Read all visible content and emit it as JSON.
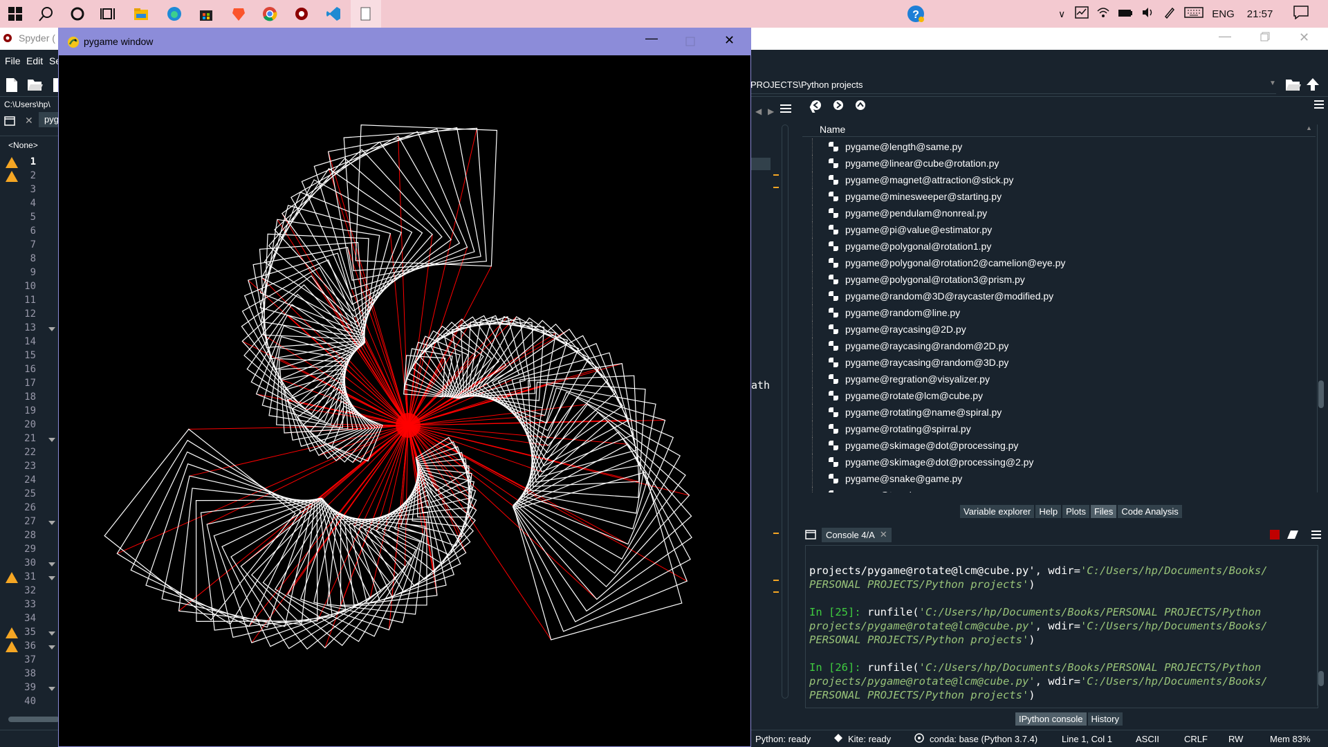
{
  "taskbar": {
    "language": "ENG",
    "time": "21:57",
    "icons": [
      "windows-start-icon",
      "search-icon",
      "cortana-icon",
      "task-view-icon",
      "file-explorer-icon",
      "edge-icon",
      "store-icon",
      "brave-icon",
      "chrome-icon",
      "spyder-icon",
      "vscode-icon",
      "blank-window-icon"
    ],
    "tray": [
      "help-icon",
      "chevron-up-icon",
      "task-manager-icon",
      "wifi-icon",
      "battery-icon",
      "volume-icon",
      "pen-icon",
      "keyboard-icon"
    ]
  },
  "spyder": {
    "title": "Spyder (",
    "menu": [
      "File",
      "Edit",
      "Se"
    ],
    "cwd_path": "C:\\Users\\hp\\",
    "editor_tab": "pyg",
    "outline_selector": "<None>",
    "line_numbers": [
      "1",
      "2",
      "3",
      "4",
      "5",
      "6",
      "7",
      "8",
      "9",
      "10",
      "11",
      "12",
      "13",
      "14",
      "15",
      "16",
      "17",
      "18",
      "19",
      "20",
      "21",
      "22",
      "23",
      "24",
      "25",
      "26",
      "27",
      "28",
      "29",
      "30",
      "31",
      "32",
      "33",
      "34",
      "35",
      "36",
      "37",
      "38",
      "39",
      "40"
    ],
    "middle_fragment": "ath",
    "files_path": "PROJECTS\\Python projects",
    "files_header": "Name",
    "files": [
      "pygame@length@same.py",
      "pygame@linear@cube@rotation.py",
      "pygame@magnet@attraction@stick.py",
      "pygame@minesweeper@starting.py",
      "pygame@pendulam@nonreal.py",
      "pygame@pi@value@estimator.py",
      "pygame@polygonal@rotation1.py",
      "pygame@polygonal@rotation2@camelion@eye.py",
      "pygame@polygonal@rotation3@prism.py",
      "pygame@random@3D@raycaster@modified.py",
      "pygame@random@line.py",
      "pygame@raycasing@2D.py",
      "pygame@raycasing@random@2D.py",
      "pygame@raycasing@random@3D.py",
      "pygame@regration@visyalizer.py",
      "pygame@rotate@lcm@cube.py",
      "pygame@rotating@name@spiral.py",
      "pygame@rotating@spirral.py",
      "pygame@skimage@dot@processing.py",
      "pygame@skimage@dot@processing@2.py",
      "pygame@snake@game.py",
      "pygame@terrain.py"
    ],
    "pane_tabs": [
      "Variable explorer",
      "Help",
      "Plots",
      "Files",
      "Code Analysis"
    ],
    "console_tab": "Console 4/A",
    "console_bottom_tabs": [
      "IPython console",
      "History"
    ],
    "console": {
      "l1_pre": "projects/pygame@rotate@lcm@cube.py', wdir=",
      "l1_str": "'C:/Users/hp/Documents/Books/",
      "l2_str": "PERSONAL PROJECTS/Python projects'",
      "l2_post": ")",
      "in25": "In [25]:",
      "in26": "In [26]:",
      "runfile": " runfile(",
      "path_a": "'C:/Users/hp/Documents/Books/PERSONAL PROJECTS/Python",
      "path_b": "projects/pygame@rotate@lcm@cube.py'",
      "wdir": ", wdir=",
      "wdir_a": "'C:/Users/hp/Documents/Books/",
      "wdir_b": "PERSONAL PROJECTS/Python projects'",
      "close": ")"
    },
    "status": {
      "python": "Python: ready",
      "kite": "Kite: ready",
      "conda": "conda: base (Python 3.7.4)",
      "position": "Line 1, Col 1",
      "encoding": "ASCII",
      "eol": "CRLF",
      "rw": "RW",
      "mem": "Mem 83%"
    }
  },
  "pygame": {
    "title": "pygame window",
    "colors": {
      "background": "#000000",
      "square": "#ffffff",
      "spoke": "#ff0000",
      "titlebar": "#8c8cd9"
    }
  }
}
